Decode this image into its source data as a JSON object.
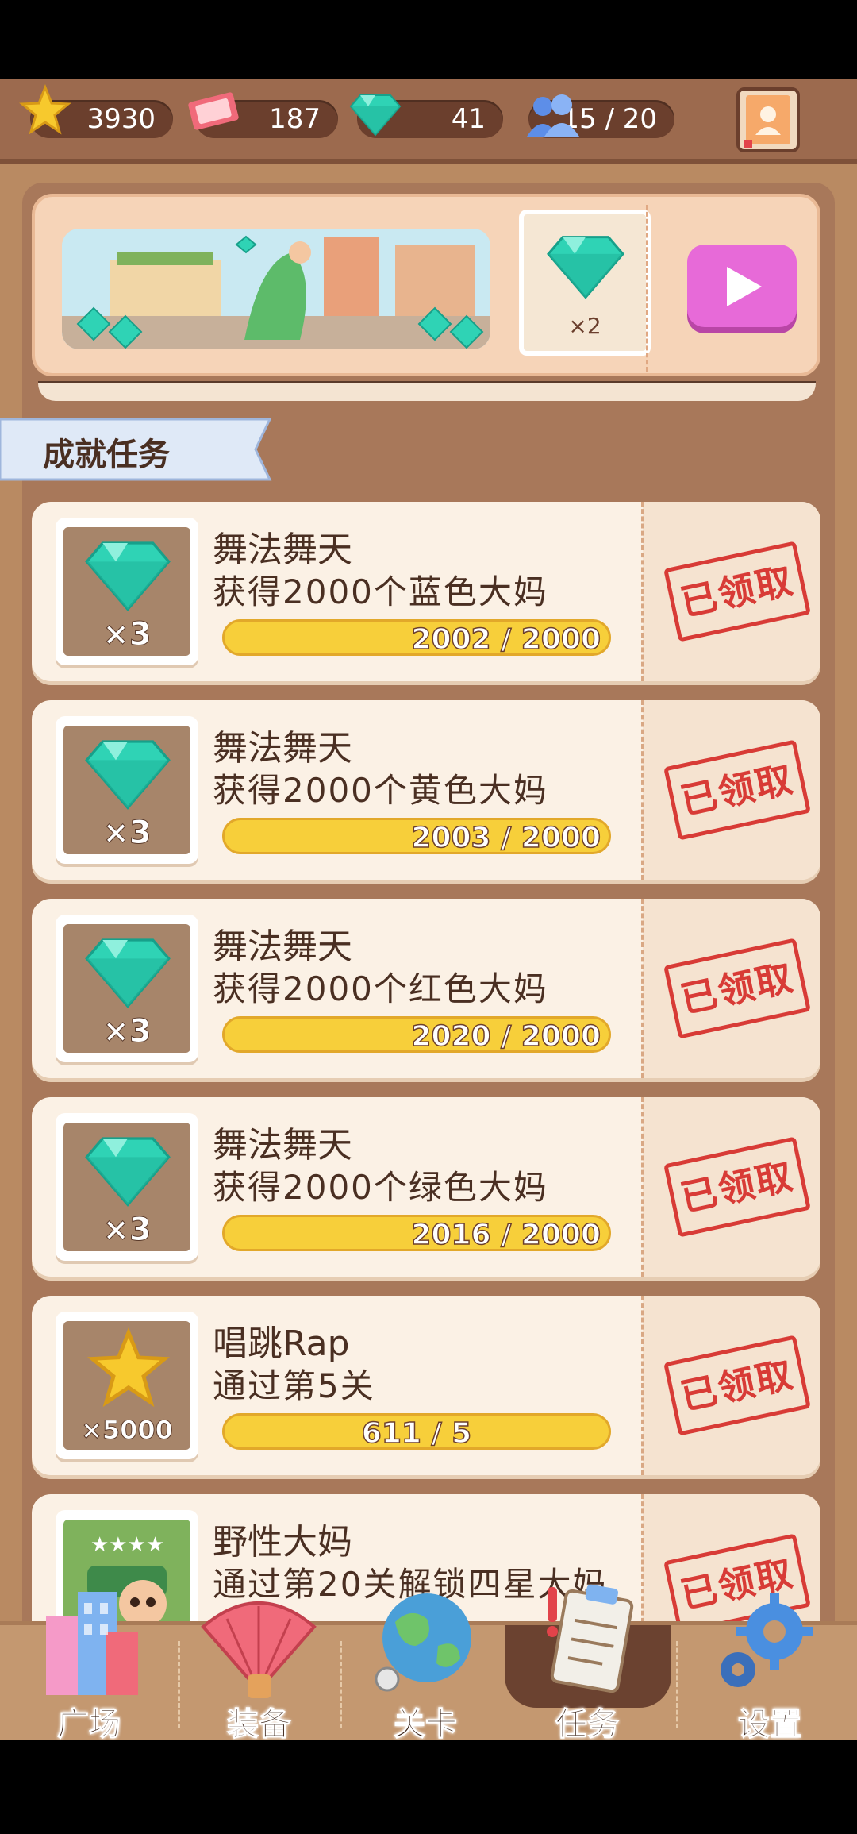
{
  "topbar": {
    "stars": "3930",
    "tickets": "187",
    "gems": "41",
    "friends": "15 / 20"
  },
  "ad": {
    "reward_mult": "×2"
  },
  "section": {
    "title": "成就任务"
  },
  "tasks": [
    {
      "title": "舞法舞天",
      "desc": "获得2000个蓝色大妈",
      "progress": "2002 / 2000",
      "reward": "×3",
      "reward_icon": "gem-icon",
      "status": "已领取"
    },
    {
      "title": "舞法舞天",
      "desc": "获得2000个黄色大妈",
      "progress": "2003 / 2000",
      "reward": "×3",
      "reward_icon": "gem-icon",
      "status": "已领取"
    },
    {
      "title": "舞法舞天",
      "desc": "获得2000个红色大妈",
      "progress": "2020 / 2000",
      "reward": "×3",
      "reward_icon": "gem-icon",
      "status": "已领取"
    },
    {
      "title": "舞法舞天",
      "desc": "获得2000个绿色大妈",
      "progress": "2016 / 2000",
      "reward": "×3",
      "reward_icon": "gem-icon",
      "status": "已领取"
    },
    {
      "title": "唱跳Rap",
      "desc": "通过第5关",
      "progress": "611 / 5",
      "reward": "×5000",
      "reward_icon": "star-icon",
      "status": "已领取"
    },
    {
      "title": "野性大妈",
      "desc": "通过第20关解锁四星大妈",
      "progress": "",
      "reward": "",
      "reward_icon": "character-card-icon",
      "status": "已领取"
    }
  ],
  "nav": {
    "items": [
      {
        "label": "广场",
        "icon": "buildings-icon"
      },
      {
        "label": "装备",
        "icon": "fan-icon"
      },
      {
        "label": "关卡",
        "icon": "globe-icon"
      },
      {
        "label": "任务",
        "icon": "clipboard-icon"
      },
      {
        "label": "设置",
        "icon": "gear-icon"
      }
    ],
    "active": "任务"
  },
  "colors": {
    "gem": "#2fd3b5",
    "stamp_red": "#d83b36",
    "bar_yellow": "#f7cf3a",
    "play_pink": "#e76ad8"
  }
}
